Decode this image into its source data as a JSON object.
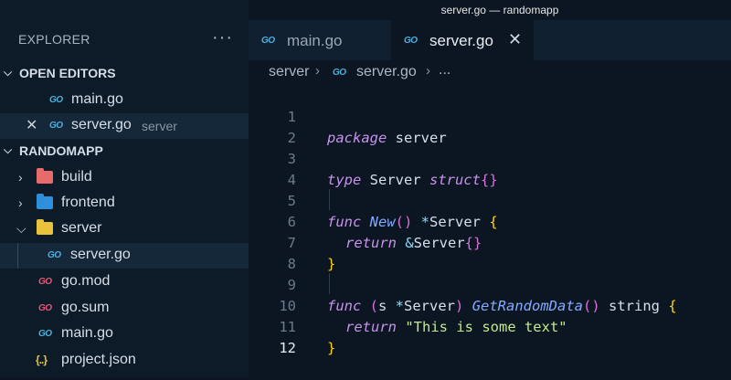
{
  "window": {
    "title": "server.go — randomapp"
  },
  "sidebar": {
    "header": "EXPLORER",
    "more": "···",
    "open_editors": {
      "label": "OPEN EDITORS",
      "items": [
        {
          "name": "main.go",
          "desc": ""
        },
        {
          "name": "server.go",
          "desc": "server"
        }
      ]
    },
    "project": {
      "label": "RANDOMAPP",
      "items": [
        {
          "name": "build"
        },
        {
          "name": "frontend"
        },
        {
          "name": "server"
        },
        {
          "name": "server.go"
        },
        {
          "name": "go.mod"
        },
        {
          "name": "go.sum"
        },
        {
          "name": "main.go"
        },
        {
          "name": "project.json"
        }
      ]
    }
  },
  "tabs": [
    {
      "label": "main.go",
      "active": false
    },
    {
      "label": "server.go",
      "active": true
    }
  ],
  "breadcrumb": [
    "server",
    "server.go",
    "..."
  ],
  "editor": {
    "current_line": 12,
    "line_numbers": [
      "1",
      "2",
      "3",
      "4",
      "5",
      "6",
      "7",
      "8",
      "9",
      "10",
      "11",
      "12"
    ],
    "tokens": {
      "package": "package",
      "server": " server",
      "type": "type",
      "Server": " Server ",
      "struct": "struct",
      "braces": "{}",
      "func": "func",
      "New": " New",
      "parens": "()",
      "star": " *",
      "Server2": "Server ",
      "lbrace": "{",
      "return": "return",
      "amp": " &",
      "Server3": "Server",
      "braces2": "{}",
      "rbrace": "}",
      "func2": "func",
      "recv_open": " (",
      "s": "s ",
      "star2": "*",
      "Server4": "Server",
      "recv_close": ")",
      "GetRandomData": " GetRandomData",
      "parens2": "()",
      "string": " string ",
      "lbrace2": "{",
      "return2": "return",
      "text": " \"This is some text\"",
      "rbrace2": "}"
    }
  },
  "colors": {
    "background": "#0b1622",
    "sidebar": "#0d1b29",
    "keyword": "#c792ea",
    "function": "#82aaff",
    "string": "#c3e88d",
    "bracket": "#ffd700",
    "go_icon": "#4db0dd",
    "go_mod_icon": "#e9567b"
  },
  "icons": {
    "go": "GO",
    "json": "{..}",
    "chevron_down": "⌵",
    "chevron_right": "›",
    "close": "✕"
  }
}
